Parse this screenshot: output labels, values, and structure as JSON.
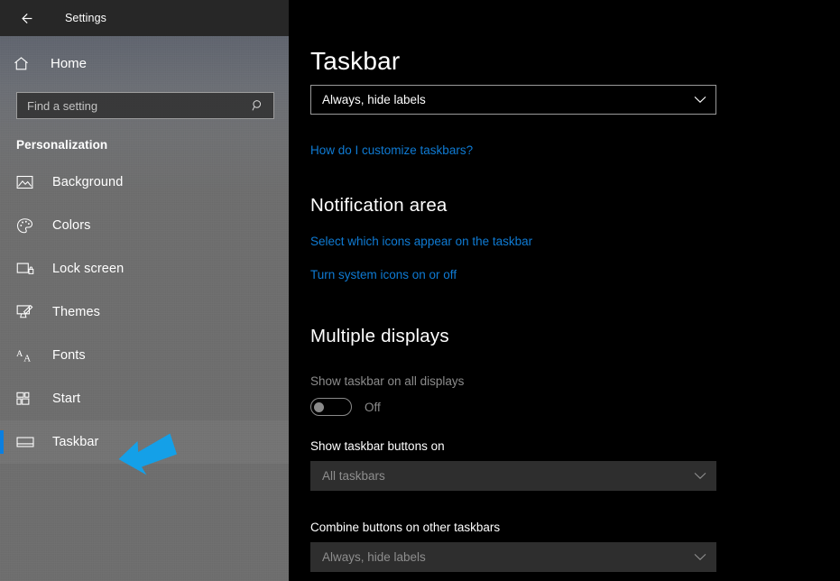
{
  "window": {
    "title": "Settings",
    "back_icon": "back-arrow-icon"
  },
  "sidebar": {
    "home": {
      "label": "Home",
      "icon": "home-icon"
    },
    "search": {
      "placeholder": "Find a setting",
      "value": "",
      "icon": "search-icon"
    },
    "group_label": "Personalization",
    "accent_color": "#0b7fe0",
    "items": [
      {
        "label": "Background",
        "icon": "image-icon",
        "selected": false
      },
      {
        "label": "Colors",
        "icon": "palette-icon",
        "selected": false
      },
      {
        "label": "Lock screen",
        "icon": "lock-screen-icon",
        "selected": false
      },
      {
        "label": "Themes",
        "icon": "themes-icon",
        "selected": false
      },
      {
        "label": "Fonts",
        "icon": "fonts-icon",
        "selected": false
      },
      {
        "label": "Start",
        "icon": "start-tiles-icon",
        "selected": false
      },
      {
        "label": "Taskbar",
        "icon": "taskbar-icon",
        "selected": true
      }
    ],
    "annotation": {
      "type": "arrow",
      "color": "#14a0e8",
      "points_to": "Taskbar"
    }
  },
  "main": {
    "page_title": "Taskbar",
    "combine_buttons": {
      "value": "Always, hide labels",
      "enabled": true,
      "chevron": "chevron-down-icon"
    },
    "help_link": "How do I customize taskbars?",
    "notification_area": {
      "heading": "Notification area",
      "links": [
        "Select which icons appear on the taskbar",
        "Turn system icons on or off"
      ]
    },
    "multiple_displays": {
      "heading": "Multiple displays",
      "show_on_all": {
        "label": "Show taskbar on all displays",
        "state": "Off",
        "checked": false,
        "enabled": false
      },
      "buttons_on": {
        "label": "Show taskbar buttons on",
        "value": "All taskbars",
        "enabled": false,
        "chevron": "chevron-down-icon"
      },
      "combine_other": {
        "label": "Combine buttons on other taskbars",
        "value": "Always, hide labels",
        "enabled": false,
        "chevron": "chevron-down-icon"
      }
    }
  },
  "colors": {
    "link": "#0f7bd4",
    "sidebar_bg": "#6b6b6b",
    "main_bg": "#000000",
    "titlebar_bg": "#272727",
    "disabled_text": "#8c8c8c",
    "disabled_field_bg": "#2e2e2e"
  }
}
